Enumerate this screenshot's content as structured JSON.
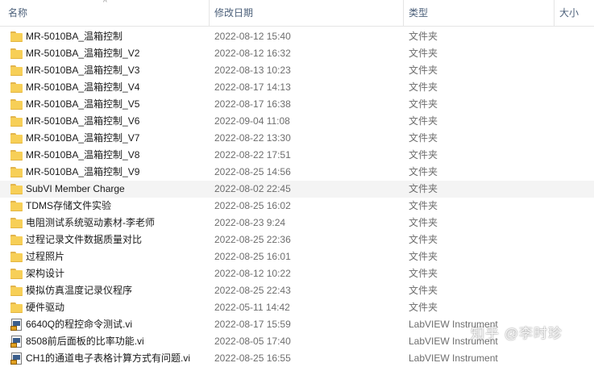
{
  "header": {
    "columns": {
      "name": "名称",
      "modified": "修改日期",
      "type": "类型",
      "size": "大小"
    }
  },
  "files": [
    {
      "name": "MR-5010BA_温箱控制",
      "modified": "2022-08-12 15:40",
      "type": "文件夹",
      "icon": "folder-icon"
    },
    {
      "name": "MR-5010BA_温箱控制_V2",
      "modified": "2022-08-12 16:32",
      "type": "文件夹",
      "icon": "folder-icon"
    },
    {
      "name": "MR-5010BA_温箱控制_V3",
      "modified": "2022-08-13 10:23",
      "type": "文件夹",
      "icon": "folder-icon"
    },
    {
      "name": "MR-5010BA_温箱控制_V4",
      "modified": "2022-08-17 14:13",
      "type": "文件夹",
      "icon": "folder-icon"
    },
    {
      "name": "MR-5010BA_温箱控制_V5",
      "modified": "2022-08-17 16:38",
      "type": "文件夹",
      "icon": "folder-icon"
    },
    {
      "name": "MR-5010BA_温箱控制_V6",
      "modified": "2022-09-04 11:08",
      "type": "文件夹",
      "icon": "folder-icon"
    },
    {
      "name": "MR-5010BA_温箱控制_V7",
      "modified": "2022-08-22 13:30",
      "type": "文件夹",
      "icon": "folder-icon"
    },
    {
      "name": "MR-5010BA_温箱控制_V8",
      "modified": "2022-08-22 17:51",
      "type": "文件夹",
      "icon": "folder-icon"
    },
    {
      "name": "MR-5010BA_温箱控制_V9",
      "modified": "2022-08-25 14:56",
      "type": "文件夹",
      "icon": "folder-icon"
    },
    {
      "name": "SubVI Member Charge",
      "modified": "2022-08-02 22:45",
      "type": "文件夹",
      "icon": "folder-icon",
      "selected": true
    },
    {
      "name": "TDMS存储文件实验",
      "modified": "2022-08-25 16:02",
      "type": "文件夹",
      "icon": "folder-icon"
    },
    {
      "name": "电阻测试系统驱动素材-李老师",
      "modified": "2022-08-23 9:24",
      "type": "文件夹",
      "icon": "folder-icon"
    },
    {
      "name": "过程记录文件数据质量对比",
      "modified": "2022-08-25 22:36",
      "type": "文件夹",
      "icon": "folder-icon"
    },
    {
      "name": "过程照片",
      "modified": "2022-08-25 16:01",
      "type": "文件夹",
      "icon": "folder-icon"
    },
    {
      "name": "架构设计",
      "modified": "2022-08-12 10:22",
      "type": "文件夹",
      "icon": "folder-icon"
    },
    {
      "name": "模拟仿真温度记录仪程序",
      "modified": "2022-08-25 22:43",
      "type": "文件夹",
      "icon": "folder-icon"
    },
    {
      "name": "硬件驱动",
      "modified": "2022-05-11 14:42",
      "type": "文件夹",
      "icon": "folder-icon"
    },
    {
      "name": "6640Q的程控命令测试.vi",
      "modified": "2022-08-17 15:59",
      "type": "LabVIEW Instrument",
      "icon": "labview-vi-icon"
    },
    {
      "name": "8508前后面板的比率功能.vi",
      "modified": "2022-08-05 17:40",
      "type": "LabVIEW Instrument",
      "icon": "labview-vi-icon"
    },
    {
      "name": "CH1的通道电子表格计算方式有问题.vi",
      "modified": "2022-08-25 16:55",
      "type": "LabVIEW Instrument",
      "icon": "labview-vi-icon"
    }
  ],
  "watermark": {
    "text": "知乎 @李时珍"
  }
}
